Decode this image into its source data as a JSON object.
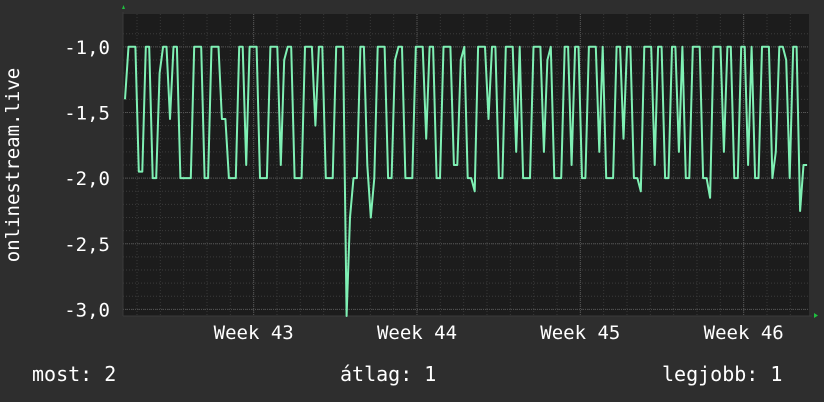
{
  "chart_data": {
    "type": "line",
    "ylabel": "onlinestream.live",
    "xlabel": "",
    "title": "",
    "ylim": [
      -3.05,
      -0.75
    ],
    "y_ticks": [
      -1.0,
      -1.5,
      -2.0,
      -2.5,
      -3.0
    ],
    "y_tick_labels": [
      "-1,0",
      "-1,5",
      "-2,0",
      "-2,5",
      "-3,0"
    ],
    "x_range_weeks": [
      42.2,
      46.4
    ],
    "x_ticks": [
      43,
      44,
      45,
      46
    ],
    "x_tick_labels": [
      "Week 43",
      "Week 44",
      "Week 45",
      "Week 46"
    ],
    "grid": true,
    "line_color": "#7ff0b4",
    "series": [
      {
        "values": [
          -1.4,
          -1.0,
          -1.0,
          -1.0,
          -1.95,
          -1.95,
          -1.0,
          -1.0,
          -2.0,
          -2.0,
          -1.2,
          -1.0,
          -1.0,
          -1.55,
          -1.0,
          -1.0,
          -2.0,
          -2.0,
          -2.0,
          -2.0,
          -1.0,
          -1.0,
          -1.0,
          -2.0,
          -2.0,
          -1.0,
          -1.0,
          -1.0,
          -1.55,
          -1.55,
          -2.0,
          -2.0,
          -2.0,
          -1.0,
          -1.0,
          -1.9,
          -1.0,
          -1.0,
          -1.0,
          -2.0,
          -2.0,
          -2.0,
          -1.0,
          -1.0,
          -1.0,
          -1.9,
          -1.1,
          -1.0,
          -1.0,
          -2.0,
          -2.0,
          -2.0,
          -1.0,
          -1.0,
          -1.0,
          -1.6,
          -1.0,
          -1.0,
          -2.0,
          -2.0,
          -2.0,
          -1.0,
          -1.0,
          -1.0,
          -3.05,
          -2.3,
          -2.0,
          -2.0,
          -1.0,
          -1.0,
          -1.9,
          -2.3,
          -2.0,
          -1.0,
          -1.0,
          -1.0,
          -2.0,
          -2.0,
          -1.1,
          -1.0,
          -1.0,
          -2.0,
          -2.0,
          -2.0,
          -1.0,
          -1.0,
          -1.0,
          -1.7,
          -1.0,
          -1.0,
          -2.0,
          -2.0,
          -1.0,
          -1.0,
          -1.0,
          -1.9,
          -1.9,
          -1.1,
          -1.0,
          -2.0,
          -2.0,
          -2.1,
          -1.0,
          -1.0,
          -1.0,
          -1.55,
          -1.0,
          -1.0,
          -2.0,
          -2.0,
          -1.0,
          -1.0,
          -1.0,
          -1.8,
          -1.0,
          -2.0,
          -2.0,
          -2.0,
          -1.0,
          -1.0,
          -1.0,
          -1.8,
          -1.1,
          -1.0,
          -2.0,
          -2.0,
          -2.0,
          -1.0,
          -1.0,
          -1.9,
          -1.0,
          -1.0,
          -2.0,
          -2.0,
          -1.0,
          -1.0,
          -1.0,
          -1.8,
          -1.0,
          -2.0,
          -2.0,
          -2.0,
          -1.0,
          -1.0,
          -1.7,
          -1.0,
          -1.0,
          -2.0,
          -2.0,
          -2.1,
          -1.0,
          -1.0,
          -1.0,
          -1.9,
          -1.0,
          -1.0,
          -2.0,
          -2.0,
          -1.0,
          -1.0,
          -1.8,
          -1.0,
          -2.0,
          -2.0,
          -1.0,
          -1.0,
          -1.0,
          -2.0,
          -2.0,
          -2.15,
          -1.0,
          -1.0,
          -1.0,
          -1.8,
          -1.0,
          -1.0,
          -2.0,
          -2.0,
          -1.0,
          -1.0,
          -1.9,
          -1.0,
          -2.0,
          -2.0,
          -1.0,
          -1.0,
          -1.0,
          -2.0,
          -1.8,
          -1.0,
          -1.0,
          -1.1,
          -2.0,
          -1.0,
          -1.0,
          -2.25,
          -1.9,
          -1.9
        ]
      }
    ]
  },
  "legend": {
    "now": "most: 2",
    "average": "átlag: 1",
    "best": "legjobb: 1"
  }
}
